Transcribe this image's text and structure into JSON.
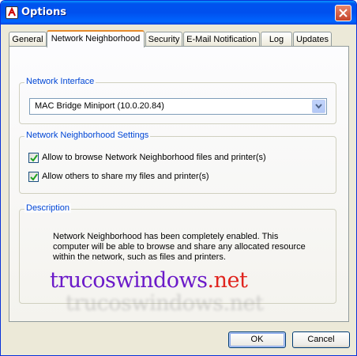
{
  "window": {
    "title": "Options",
    "close_icon": "close-icon",
    "app_icon": "options-app-icon"
  },
  "tabs": [
    {
      "label": "General",
      "active": false
    },
    {
      "label": "Network Neighborhood",
      "active": true
    },
    {
      "label": "Security",
      "active": false
    },
    {
      "label": "E-Mail Notification",
      "active": false
    },
    {
      "label": "Log",
      "active": false
    },
    {
      "label": "Updates",
      "active": false
    }
  ],
  "network_interface": {
    "group_label": "Network Interface",
    "selected": "MAC Bridge Miniport (10.0.20.84)"
  },
  "settings": {
    "group_label": "Network Neighborhood Settings",
    "options": [
      {
        "label": "Allow to browse Network Neighborhood files and printer(s)",
        "checked": true
      },
      {
        "label": "Allow others to share my files and printer(s)",
        "checked": true
      }
    ]
  },
  "description": {
    "group_label": "Description",
    "lines": [
      "Network Neighborhood has been completely enabled.  This",
      "computer will be able to browse and share any allocated resource",
      "within the network, such as files and printers."
    ]
  },
  "watermark": {
    "main": "trucoswindows",
    "suffix": ".net",
    "shadow": "trucoswindows.net"
  },
  "buttons": {
    "ok": "OK",
    "cancel": "Cancel"
  },
  "colors": {
    "title_bar": "#0053ee",
    "group_label": "#0046d5",
    "active_tab_accent": "#e68b2c",
    "watermark": "#6b1ac9",
    "watermark_accent": "#e0241e"
  }
}
